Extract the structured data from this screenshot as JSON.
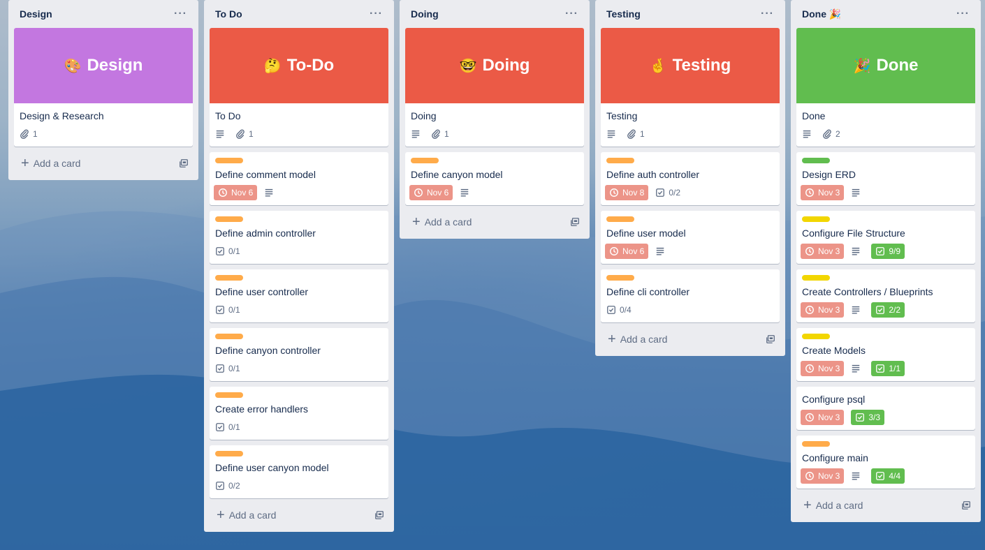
{
  "colors": {
    "design_cover": "#c377e0",
    "red_cover": "#eb5a46",
    "done_cover": "#61bd4f",
    "label_orange": "#ffab4a",
    "label_green": "#61bd4f",
    "label_yellow": "#f2d600",
    "due_badge": "#ec9488",
    "checklist_done": "#61bd4f"
  },
  "add_card_label": "Add a card",
  "lists": [
    {
      "title": "Design",
      "cover": {
        "emoji": "🎨",
        "text": "Design"
      },
      "cover_card": {
        "title": "Design & Research",
        "attachments": "1"
      },
      "cards": []
    },
    {
      "title": "To Do",
      "cover": {
        "emoji": "🤔",
        "text": "To-Do"
      },
      "cover_card": {
        "title": "To Do",
        "attachments": "1"
      },
      "cards": [
        {
          "label": "orange",
          "title": "Define comment model",
          "due": "Nov 6",
          "description": true
        },
        {
          "label": "orange",
          "title": "Define admin controller",
          "checklist": "0/1"
        },
        {
          "label": "orange",
          "title": "Define user controller",
          "checklist": "0/1"
        },
        {
          "label": "orange",
          "title": "Define canyon controller",
          "checklist": "0/1"
        },
        {
          "label": "orange",
          "title": "Create error handlers",
          "checklist": "0/1"
        },
        {
          "label": "orange",
          "title": "Define user canyon model",
          "checklist": "0/2"
        }
      ]
    },
    {
      "title": "Doing",
      "cover": {
        "emoji": "🤓",
        "text": "Doing"
      },
      "cover_card": {
        "title": "Doing",
        "attachments": "1"
      },
      "cards": [
        {
          "label": "orange",
          "title": "Define canyon model",
          "due": "Nov 6",
          "description": true
        }
      ]
    },
    {
      "title": "Testing",
      "cover": {
        "emoji": "🤞",
        "text": "Testing"
      },
      "cover_card": {
        "title": "Testing",
        "attachments": "1"
      },
      "cards": [
        {
          "label": "orange",
          "title": "Define auth controller",
          "due": "Nov 8",
          "checklist": "0/2"
        },
        {
          "label": "orange",
          "title": "Define user model",
          "due": "Nov 6",
          "description": true
        },
        {
          "label": "orange",
          "title": "Define cli controller",
          "checklist": "0/4"
        }
      ]
    },
    {
      "title": "Done 🎉",
      "cover": {
        "emoji": "🎉",
        "text": "Done"
      },
      "cover_card": {
        "title": "Done",
        "attachments": "2"
      },
      "cards": [
        {
          "label": "green",
          "title": "Design ERD",
          "due": "Nov 3",
          "description": true
        },
        {
          "label": "yellow",
          "title": "Configure File Structure",
          "due": "Nov 3",
          "description": true,
          "checklist": "9/9",
          "checklist_complete": true
        },
        {
          "label": "yellow",
          "title": "Create Controllers / Blueprints",
          "due": "Nov 3",
          "description": true,
          "checklist": "2/2",
          "checklist_complete": true
        },
        {
          "label": "yellow",
          "title": "Create Models",
          "due": "Nov 3",
          "description": true,
          "checklist": "1/1",
          "checklist_complete": true
        },
        {
          "label": null,
          "title": "Configure psql",
          "due": "Nov 3",
          "checklist": "3/3",
          "checklist_complete": true
        },
        {
          "label": "orange",
          "title": "Configure main",
          "due": "Nov 3",
          "description": true,
          "checklist": "4/4",
          "checklist_complete": true
        }
      ]
    }
  ]
}
